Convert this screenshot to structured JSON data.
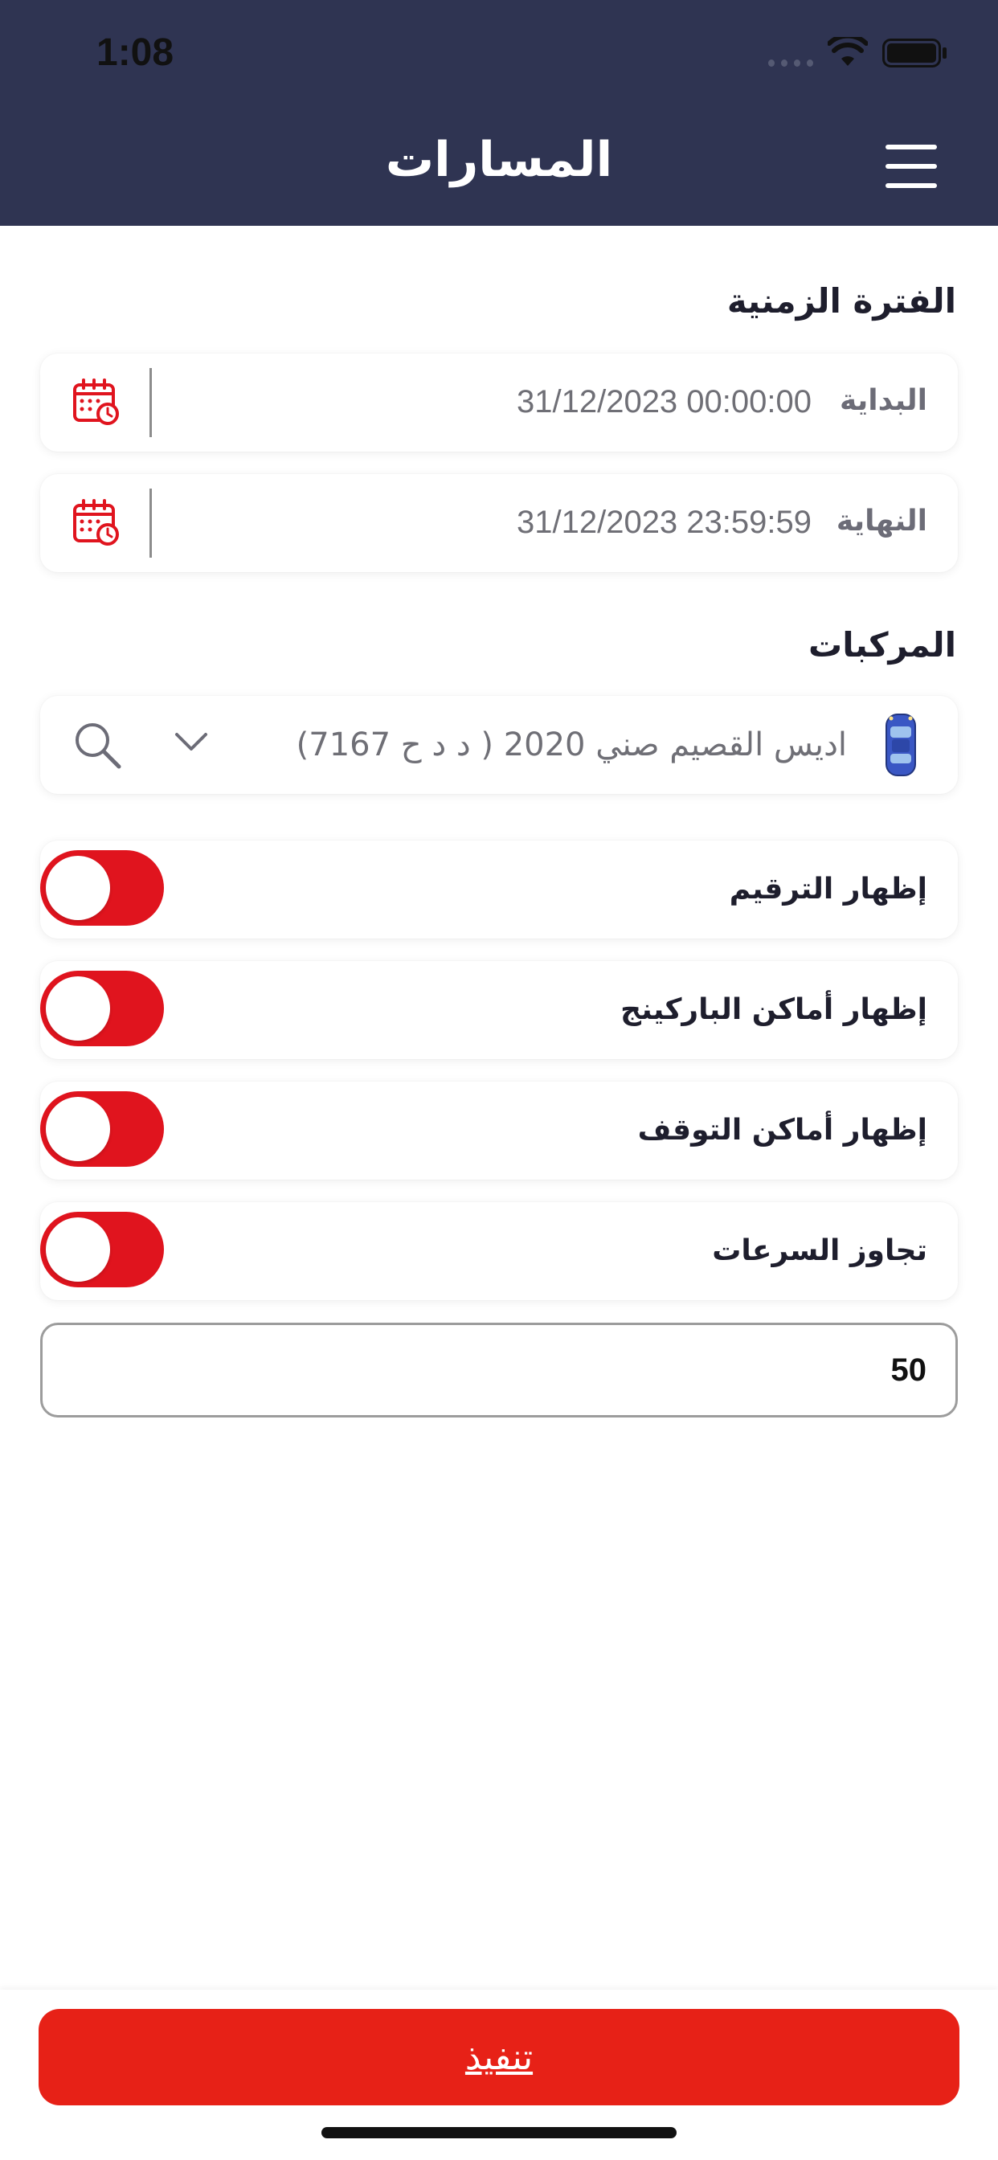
{
  "status_bar": {
    "time": "1:08"
  },
  "header": {
    "title": "المسارات"
  },
  "period": {
    "title": "الفترة الزمنية",
    "start": {
      "label": "البداية",
      "value": "31/12/2023 00:00:00"
    },
    "end": {
      "label": "النهاية",
      "value": "31/12/2023 23:59:59"
    }
  },
  "vehicles": {
    "title": "المركبات",
    "selected": "اديس القصيم صني 2020 ( د د ح 7167)"
  },
  "toggles": [
    {
      "label": "إظهار الترقيم"
    },
    {
      "label": "إظهار أماكن الباركينج"
    },
    {
      "label": "إظهار أماكن التوقف"
    },
    {
      "label": "تجاوز السرعات"
    }
  ],
  "speed_limit": {
    "value": "50"
  },
  "footer": {
    "execute_label": "تنفيذ"
  },
  "colors": {
    "header": "#2f3452",
    "accent": "#e0141e",
    "button": "#e72117"
  }
}
